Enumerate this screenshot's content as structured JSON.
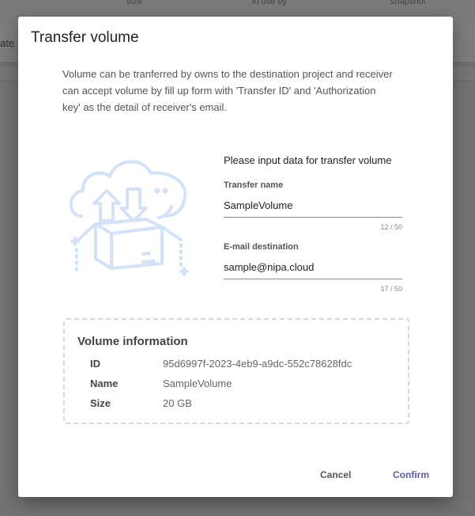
{
  "background": {
    "columns": [
      "size",
      "in use by",
      "snapshot"
    ],
    "bar_text": "ate"
  },
  "modal": {
    "title": "Transfer volume",
    "description": "Volume can be tranferred by owns to the destination project and receiver can accept volume by fill up form with 'Transfer ID' and 'Authorization key' as the detail of receiver's email.",
    "illustration_icon": "cloud-transfer-box-icon",
    "form": {
      "heading": "Please input data for transfer volume",
      "transfer_name": {
        "label": "Transfer name",
        "value": "SampleVolume",
        "counter": "12 / 50"
      },
      "email": {
        "label": "E-mail destination",
        "value": "sample@nipa.cloud",
        "counter": "17 / 50"
      }
    },
    "volume_info": {
      "title": "Volume information",
      "rows": [
        {
          "key": "ID",
          "value": "95d6997f-2023-4eb9-a9dc-552c78628fdc"
        },
        {
          "key": "Name",
          "value": "SampleVolume"
        },
        {
          "key": "Size",
          "value": "20 GB"
        }
      ]
    },
    "buttons": {
      "cancel": "Cancel",
      "confirm": "Confirm"
    },
    "colors": {
      "accent": "#5a5a9c",
      "illustration": "#d5e1f6"
    }
  }
}
